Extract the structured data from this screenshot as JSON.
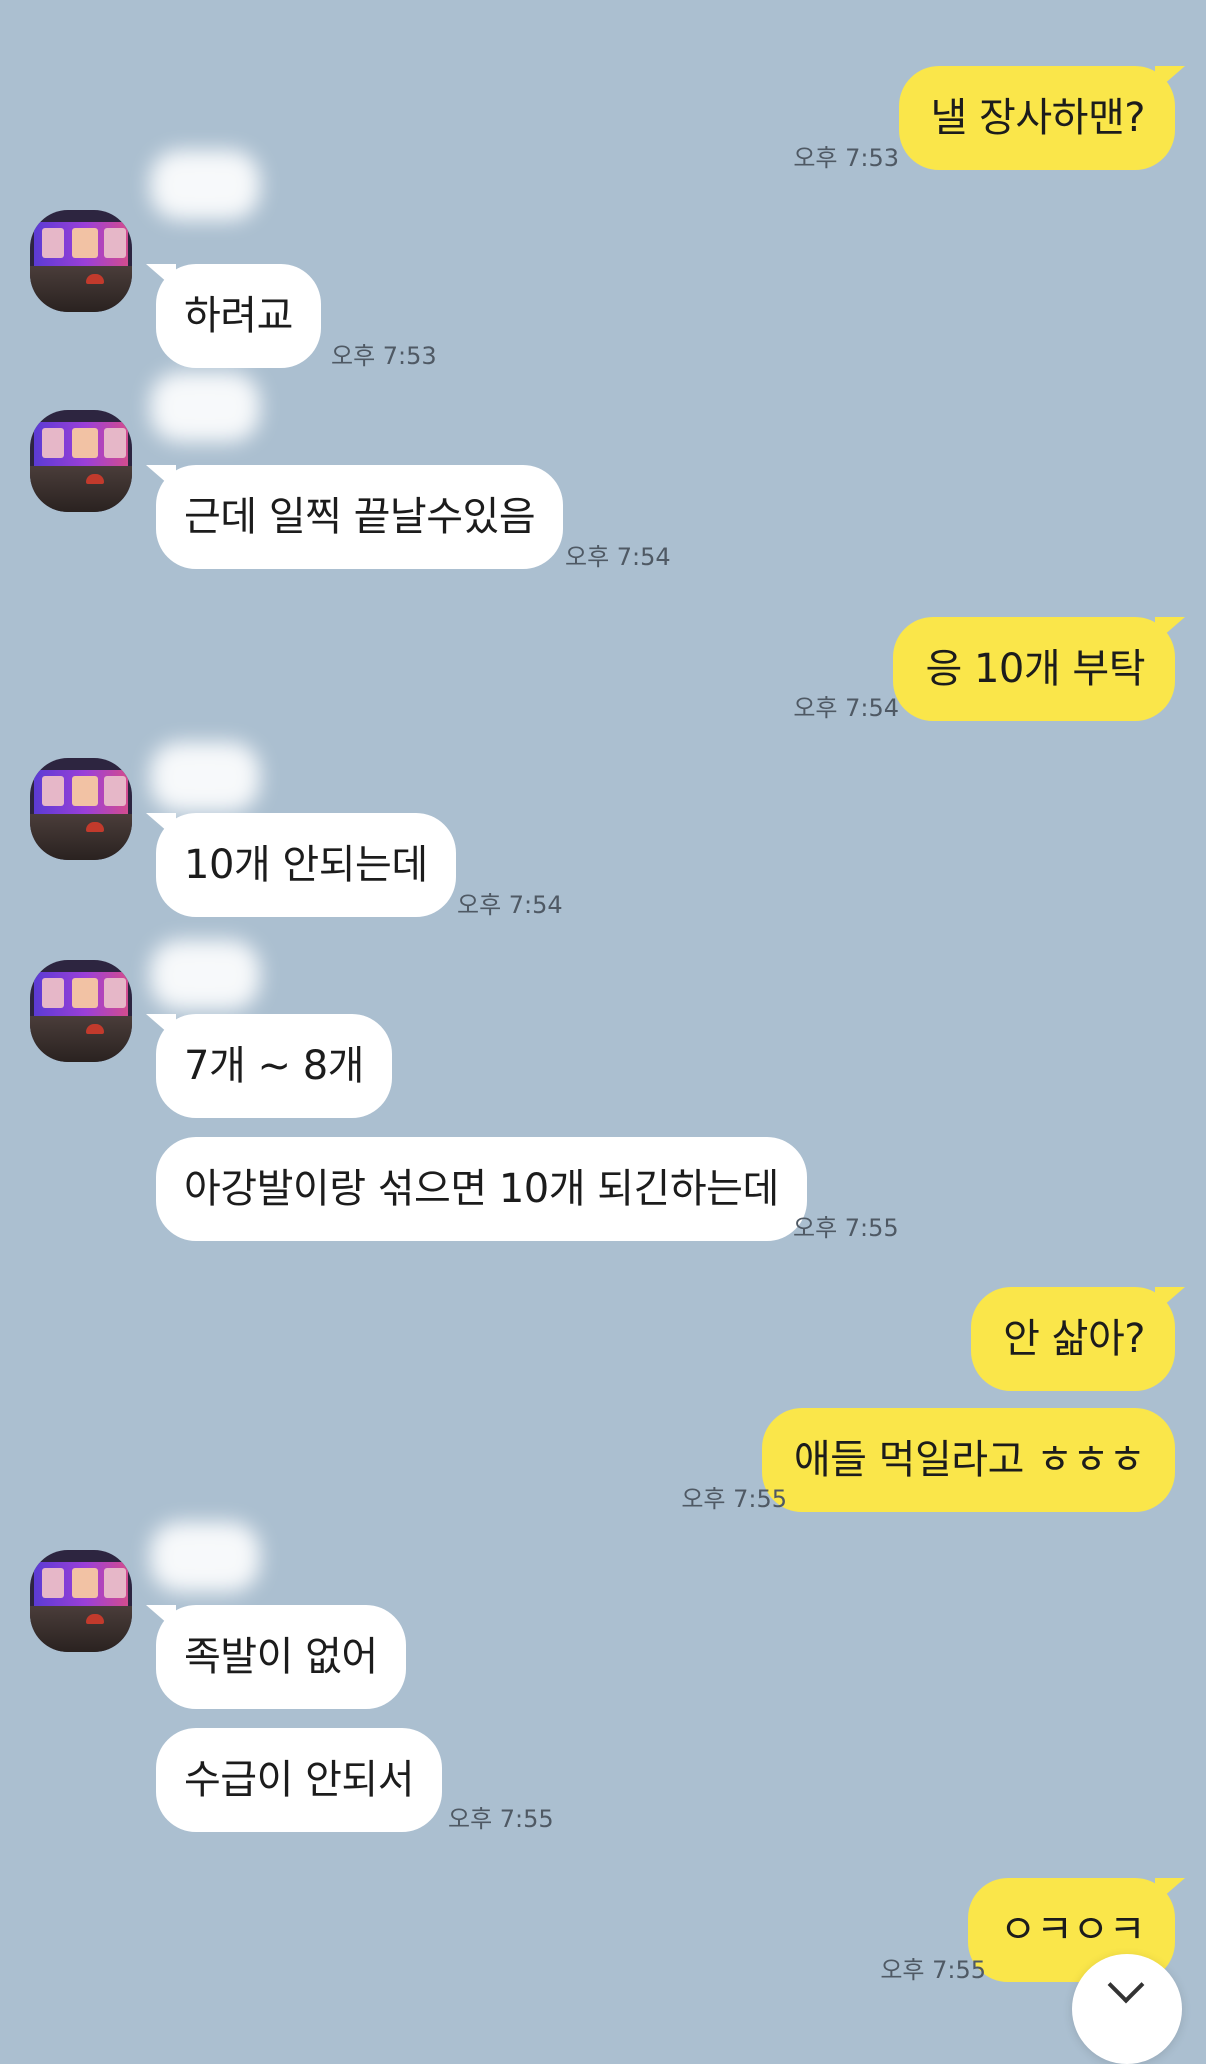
{
  "messages": [
    {
      "side": "out",
      "text": "낼 장사하맨?",
      "time": "오후 7:53"
    },
    {
      "side": "in",
      "text": "하려교",
      "time": "오후 7:53"
    },
    {
      "side": "in",
      "text": "근데 일찍 끝날수있음",
      "time": "오후 7:54"
    },
    {
      "side": "out",
      "text": "응 10개 부탁",
      "time": "오후 7:54"
    },
    {
      "side": "in",
      "text": "10개 안되는데",
      "time": "오후 7:54"
    },
    {
      "side": "in",
      "text": "7개 ~ 8개",
      "time": ""
    },
    {
      "side": "in",
      "text": "아강발이랑 섞으면 10개 되긴하는데",
      "time": "오후 7:55"
    },
    {
      "side": "out",
      "text": "안 삶아?",
      "time": ""
    },
    {
      "side": "out",
      "text": "애들 먹일라고 ㅎㅎㅎ",
      "time": "오후 7:55"
    },
    {
      "side": "in",
      "text": "족발이 없어",
      "time": ""
    },
    {
      "side": "in",
      "text": "수급이 안되서",
      "time": "오후 7:55"
    },
    {
      "side": "out",
      "text": "ㅇㅋㅇㅋ",
      "time": "오후 7:55"
    }
  ],
  "icons": {
    "avatar": "profile-photo-conference",
    "scroll": "chevron-down-icon"
  },
  "colors": {
    "background": "#abbfd0",
    "outgoing_bubble": "#fae64a",
    "incoming_bubble": "#ffffff"
  }
}
